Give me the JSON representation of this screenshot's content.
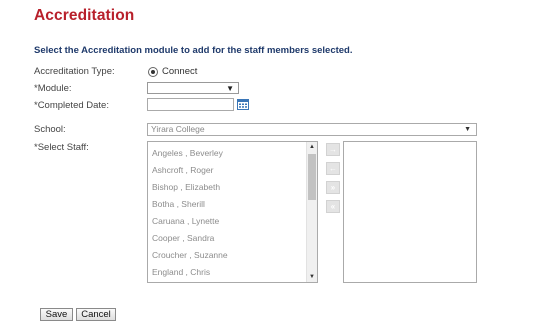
{
  "page": {
    "title": "Accreditation",
    "subtitle": "Select the Accreditation module to add for the staff members selected."
  },
  "form": {
    "accreditation_type_label": "Accreditation Type:",
    "accreditation_type_value": "Connect",
    "module_label": "*Module:",
    "module_value": "",
    "completed_date_label": "*Completed Date:",
    "completed_date_value": "",
    "school_label": "School:",
    "school_value": "Yirara College",
    "select_staff_label": "*Select Staff:"
  },
  "staff_list": [
    "Angeles , Beverley",
    "Ashcroft , Roger",
    "Bishop , Elizabeth",
    "Botha , Sherill",
    "Caruana , Lynette",
    "Cooper , Sandra",
    "Croucher , Suzanne",
    "England , Chris"
  ],
  "move_buttons": {
    "add_one": "→",
    "remove_one": "←",
    "add_all": "»",
    "remove_all": "«"
  },
  "buttons": {
    "save": "Save",
    "cancel": "Cancel"
  },
  "icons": {
    "calendar": "calendar-icon",
    "dropdown": "chevron-down-icon"
  },
  "colors": {
    "title": "#b8202b",
    "subtitle": "#1f3a6b"
  }
}
